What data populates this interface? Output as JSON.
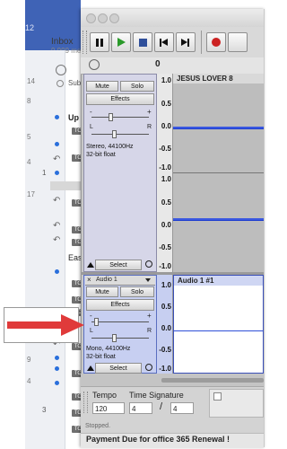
{
  "mail": {
    "top_number": "12",
    "folder": "Inbox",
    "count": "9,999 me",
    "sub_label": "Sub",
    "subject_prefix": "Up",
    "east_prefix": "Eas",
    "side_numbers": [
      "14",
      "8",
      "5",
      "4",
      "17",
      "9",
      "4"
    ],
    "row_numbers": [
      "1",
      "3"
    ],
    "tag_label": "TO",
    "bottom_subject": "Payment Due for office 365 Renewal !"
  },
  "audacity": {
    "ruler_start": "0",
    "track1": {
      "title": "",
      "mute": "Mute",
      "solo": "Solo",
      "effects": "Effects",
      "gain_minus": "-",
      "gain_plus": "+",
      "pan_left": "L",
      "pan_right": "R",
      "info_line1": "Stereo, 44100Hz",
      "info_line2": "32-bit float",
      "select": "Select",
      "clip_label": "JESUS LOVER 8",
      "scale": [
        "1.0",
        "0.5",
        "0.0",
        "-0.5",
        "-1.0"
      ]
    },
    "track2": {
      "title": "Audio 1",
      "mute": "Mute",
      "solo": "Solo",
      "effects": "Effects",
      "gain_minus": "-",
      "gain_plus": "+",
      "pan_left": "L",
      "pan_right": "R",
      "info_line1": "Mono, 44100Hz",
      "info_line2": "32-bit float",
      "select": "Select",
      "clip_label": "Audio 1 #1",
      "scale": [
        "1.0",
        "0.5",
        "0.0",
        "-0.5",
        "-1.0"
      ]
    },
    "tempo_label": "Tempo",
    "tempo_value": "120",
    "timesig_label": "Time Signature",
    "timesig_num": "4",
    "timesig_sep": "/",
    "timesig_den": "4",
    "status": "Stopped."
  },
  "colors": {
    "mail_header": "#3f63b6",
    "wave": "#2f50d8",
    "selected_track": "#c7cff1",
    "record": "#cc2222",
    "arrow": "#e03a3a"
  }
}
